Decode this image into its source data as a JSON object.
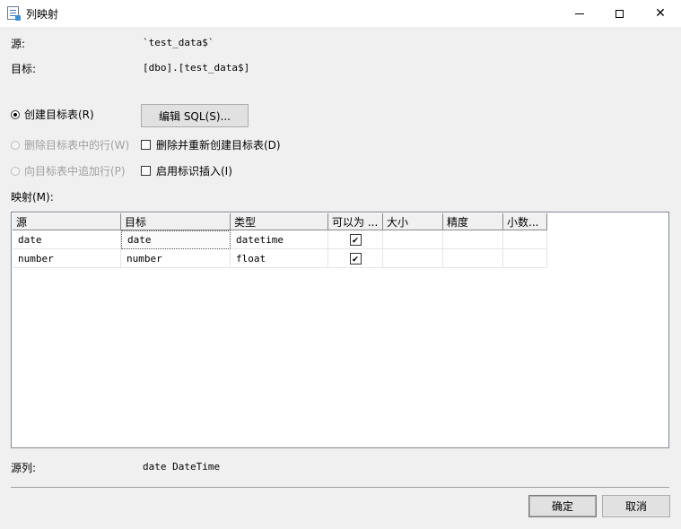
{
  "window": {
    "title": "列映射"
  },
  "fields": {
    "source_label": "源:",
    "source_value": "`test_data$`",
    "target_label": "目标:",
    "target_value": "[dbo].[test_data$]"
  },
  "options": {
    "create_table": "创建目标表(R)",
    "delete_rows": "删除目标表中的行(W)",
    "append_rows": "向目标表中追加行(P)",
    "drop_recreate": "删除并重新创建目标表(D)",
    "identity_insert": "启用标识插入(I)",
    "edit_sql_button": "编辑 SQL(S)..."
  },
  "mappings": {
    "label": "映射(M):",
    "columns": [
      "源",
      "目标",
      "类型",
      "可以为 ...",
      "大小",
      "精度",
      "小数..."
    ],
    "rows": [
      {
        "source": "date",
        "target": "date",
        "type": "datetime",
        "nullable": true,
        "size": "",
        "precision": "",
        "scale": ""
      },
      {
        "source": "number",
        "target": "number",
        "type": "float",
        "nullable": true,
        "size": "",
        "precision": "",
        "scale": ""
      }
    ]
  },
  "footer": {
    "source_column_label": "源列:",
    "source_column_value": "date DateTime",
    "ok_button": "确定",
    "cancel_button": "取消"
  },
  "icons": {
    "app": "column-mapping-icon",
    "minimize": "minimize-icon",
    "maximize": "maximize-icon",
    "close": "close-icon",
    "check": "✔"
  }
}
